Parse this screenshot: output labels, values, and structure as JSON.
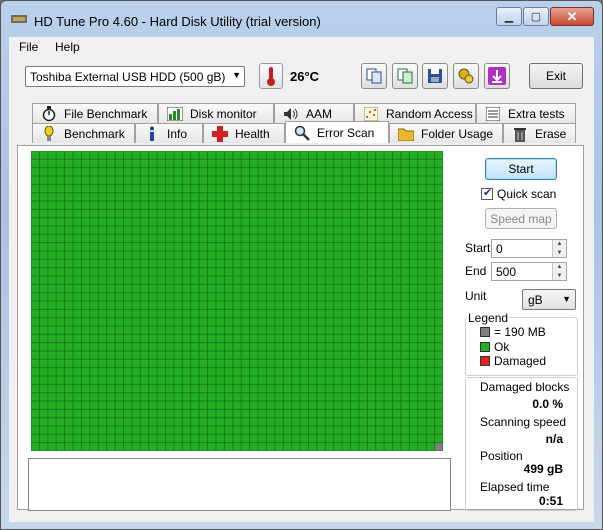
{
  "window": {
    "title": "HD Tune Pro 4.60 - Hard Disk Utility (trial version)"
  },
  "menu": {
    "file": "File",
    "help": "Help"
  },
  "toolbar": {
    "drive": "Toshiba External USB HDD (500 gB)",
    "temperature": "26°C",
    "exit_label": "Exit"
  },
  "tabs_top": [
    {
      "label": "File Benchmark",
      "icon": "stopwatch-icon"
    },
    {
      "label": "Disk monitor",
      "icon": "disk-monitor-icon"
    },
    {
      "label": "AAM",
      "icon": "speaker-icon"
    },
    {
      "label": "Random Access",
      "icon": "random-access-icon"
    },
    {
      "label": "Extra tests",
      "icon": "extra-tests-icon"
    }
  ],
  "tabs_bottom": [
    {
      "label": "Benchmark",
      "icon": "benchmark-icon"
    },
    {
      "label": "Info",
      "icon": "info-icon"
    },
    {
      "label": "Health",
      "icon": "health-cross-icon"
    },
    {
      "label": "Error Scan",
      "icon": "magnifier-icon",
      "active": true
    },
    {
      "label": "Folder Usage",
      "icon": "folder-icon"
    },
    {
      "label": "Erase",
      "icon": "trash-icon"
    }
  ],
  "scan": {
    "start_button": "Start",
    "quick_scan_label": "Quick scan",
    "quick_scan_checked": true,
    "speed_map_button": "Speed map",
    "start_label": "Start",
    "start_value": "0",
    "end_label": "End",
    "end_value": "500",
    "unit_label": "Unit",
    "unit_value": "gB",
    "grid_cols": 49,
    "grid_rows": 36,
    "ok_color": "#22b022",
    "damaged_color": "#e02020",
    "block_size_color": "#808080",
    "last_block_color": "#808080"
  },
  "legend": {
    "title": "Legend",
    "block_size": "= 190 MB",
    "ok": "Ok",
    "damaged": "Damaged"
  },
  "stats": {
    "damaged_blocks_label": "Damaged blocks",
    "damaged_blocks_value": "0.0 %",
    "scanning_speed_label": "Scanning speed",
    "scanning_speed_value": "n/a",
    "position_label": "Position",
    "position_value": "499 gB",
    "elapsed_label": "Elapsed time",
    "elapsed_value": "0:51"
  }
}
